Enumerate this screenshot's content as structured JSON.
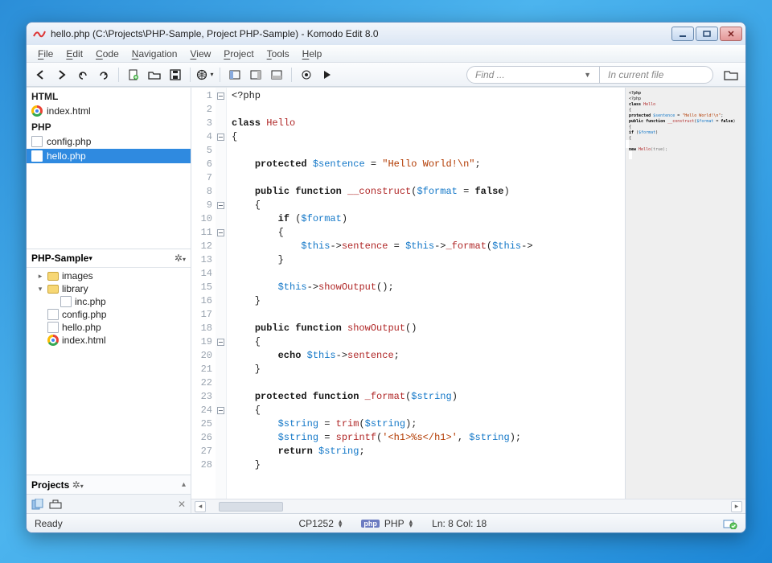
{
  "window": {
    "title": "hello.php (C:\\Projects\\PHP-Sample, Project PHP-Sample) - Komodo Edit 8.0"
  },
  "menu": [
    "File",
    "Edit",
    "Code",
    "Navigation",
    "View",
    "Project",
    "Tools",
    "Help"
  ],
  "find": {
    "placeholder": "Find ...",
    "scope": "In current file"
  },
  "sidebar": {
    "group1": "HTML",
    "g1_items": [
      {
        "label": "index.html",
        "icon": "chrome"
      }
    ],
    "group2": "PHP",
    "g2_items": [
      {
        "label": "config.php",
        "icon": "file"
      },
      {
        "label": "hello.php",
        "icon": "file",
        "selected": true
      }
    ],
    "project_name": "PHP-Sample",
    "tree": [
      {
        "indent": 0,
        "tw": "▸",
        "icon": "folder",
        "label": "images"
      },
      {
        "indent": 0,
        "tw": "▾",
        "icon": "folder",
        "label": "library"
      },
      {
        "indent": 1,
        "tw": "",
        "icon": "file",
        "label": "inc.php"
      },
      {
        "indent": 0,
        "tw": "",
        "icon": "file",
        "label": "config.php"
      },
      {
        "indent": 0,
        "tw": "",
        "icon": "file",
        "label": "hello.php"
      },
      {
        "indent": 0,
        "tw": "",
        "icon": "chrome",
        "label": "index.html"
      }
    ],
    "projects_label": "Projects"
  },
  "code": {
    "lines": [
      {
        "n": 1,
        "fold": "box",
        "tokens": [
          [
            "op",
            "<?php"
          ]
        ]
      },
      {
        "n": 2,
        "tokens": []
      },
      {
        "n": 3,
        "tokens": [
          [
            "kw",
            "class "
          ],
          [
            "cls",
            "Hello"
          ]
        ]
      },
      {
        "n": 4,
        "fold": "box",
        "tokens": [
          [
            "op",
            "{"
          ]
        ]
      },
      {
        "n": 5,
        "tokens": []
      },
      {
        "n": 6,
        "tokens": [
          [
            "op",
            "    "
          ],
          [
            "kw",
            "protected "
          ],
          [
            "var",
            "$sentence"
          ],
          [
            "op",
            " = "
          ],
          [
            "str",
            "\"Hello World!\\n\""
          ],
          [
            "op",
            ";"
          ]
        ]
      },
      {
        "n": 7,
        "tokens": []
      },
      {
        "n": 8,
        "tokens": [
          [
            "op",
            "    "
          ],
          [
            "kw",
            "public function "
          ],
          [
            "fn",
            "__construct"
          ],
          [
            "op",
            "("
          ],
          [
            "var",
            "$format"
          ],
          [
            "op",
            " = "
          ],
          [
            "kw",
            "false"
          ],
          [
            "op",
            ")"
          ]
        ]
      },
      {
        "n": 9,
        "fold": "box",
        "tokens": [
          [
            "op",
            "    {"
          ]
        ]
      },
      {
        "n": 10,
        "tokens": [
          [
            "op",
            "        "
          ],
          [
            "kw",
            "if"
          ],
          [
            "op",
            " ("
          ],
          [
            "var",
            "$format"
          ],
          [
            "op",
            ")"
          ]
        ]
      },
      {
        "n": 11,
        "fold": "box",
        "tokens": [
          [
            "op",
            "        {"
          ]
        ]
      },
      {
        "n": 12,
        "tokens": [
          [
            "op",
            "            "
          ],
          [
            "var",
            "$this"
          ],
          [
            "op",
            "->"
          ],
          [
            "fn",
            "sentence"
          ],
          [
            "op",
            " = "
          ],
          [
            "var",
            "$this"
          ],
          [
            "op",
            "->"
          ],
          [
            "fn",
            "_format"
          ],
          [
            "op",
            "("
          ],
          [
            "var",
            "$this"
          ],
          [
            "op",
            "->"
          ]
        ]
      },
      {
        "n": 13,
        "tokens": [
          [
            "op",
            "        }"
          ]
        ]
      },
      {
        "n": 14,
        "tokens": []
      },
      {
        "n": 15,
        "tokens": [
          [
            "op",
            "        "
          ],
          [
            "var",
            "$this"
          ],
          [
            "op",
            "->"
          ],
          [
            "fn",
            "showOutput"
          ],
          [
            "op",
            "();"
          ]
        ]
      },
      {
        "n": 16,
        "tokens": [
          [
            "op",
            "    }"
          ]
        ]
      },
      {
        "n": 17,
        "tokens": []
      },
      {
        "n": 18,
        "tokens": [
          [
            "op",
            "    "
          ],
          [
            "kw",
            "public function "
          ],
          [
            "fn",
            "showOutput"
          ],
          [
            "op",
            "()"
          ]
        ]
      },
      {
        "n": 19,
        "fold": "box",
        "tokens": [
          [
            "op",
            "    {"
          ]
        ]
      },
      {
        "n": 20,
        "tokens": [
          [
            "op",
            "        "
          ],
          [
            "kw",
            "echo "
          ],
          [
            "var",
            "$this"
          ],
          [
            "op",
            "->"
          ],
          [
            "fn",
            "sentence"
          ],
          [
            "op",
            ";"
          ]
        ]
      },
      {
        "n": 21,
        "tokens": [
          [
            "op",
            "    }"
          ]
        ]
      },
      {
        "n": 22,
        "tokens": []
      },
      {
        "n": 23,
        "tokens": [
          [
            "op",
            "    "
          ],
          [
            "kw",
            "protected function "
          ],
          [
            "fn",
            "_format"
          ],
          [
            "op",
            "("
          ],
          [
            "var",
            "$string"
          ],
          [
            "op",
            ")"
          ]
        ]
      },
      {
        "n": 24,
        "fold": "box",
        "tokens": [
          [
            "op",
            "    {"
          ]
        ]
      },
      {
        "n": 25,
        "tokens": [
          [
            "op",
            "        "
          ],
          [
            "var",
            "$string"
          ],
          [
            "op",
            " = "
          ],
          [
            "fn",
            "trim"
          ],
          [
            "op",
            "("
          ],
          [
            "var",
            "$string"
          ],
          [
            "op",
            ");"
          ]
        ]
      },
      {
        "n": 26,
        "tokens": [
          [
            "op",
            "        "
          ],
          [
            "var",
            "$string"
          ],
          [
            "op",
            " = "
          ],
          [
            "fn",
            "sprintf"
          ],
          [
            "op",
            "("
          ],
          [
            "str",
            "'<h1>%s</h1>'"
          ],
          [
            "op",
            ", "
          ],
          [
            "var",
            "$string"
          ],
          [
            "op",
            ");"
          ]
        ]
      },
      {
        "n": 27,
        "tokens": [
          [
            "op",
            "        "
          ],
          [
            "kw",
            "return "
          ],
          [
            "var",
            "$string"
          ],
          [
            "op",
            ";"
          ]
        ]
      },
      {
        "n": 28,
        "tokens": [
          [
            "op",
            "    }"
          ]
        ]
      }
    ]
  },
  "status": {
    "ready": "Ready",
    "encoding": "CP1252",
    "lang": "PHP",
    "pos": "Ln: 8 Col: 18"
  }
}
